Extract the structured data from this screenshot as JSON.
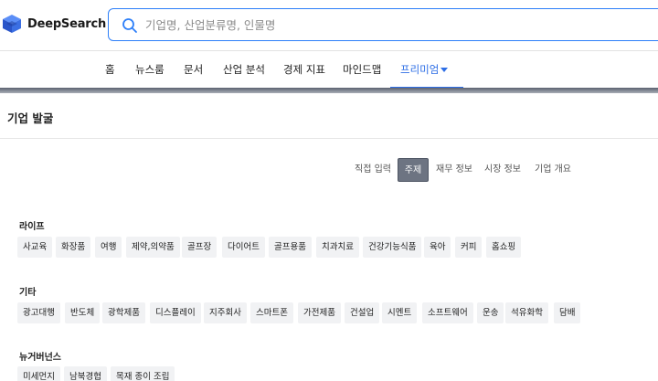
{
  "brand": {
    "name": "DeepSearch"
  },
  "search": {
    "placeholder": "기업명, 산업분류명, 인물명"
  },
  "nav": [
    "홈",
    "뉴스룸",
    "문서",
    "산업 분석",
    "경제 지표",
    "마인드맵",
    "프리미엄"
  ],
  "nav_active": "프리미엄",
  "page_title": "기업 발굴",
  "tabs": [
    "직접 입력",
    "주제",
    "재무 정보",
    "시장 정보",
    "기업 개요"
  ],
  "active_tab": "주제",
  "sections": [
    {
      "title": "라이프",
      "chips": [
        "사교육",
        "화장품",
        "여행",
        "제약,의약품",
        "골프장",
        "다이어트",
        "골프용품",
        "치과치료",
        "건강기능식품",
        "육아",
        "커피",
        "홈쇼핑"
      ]
    },
    {
      "title": "기타",
      "chips": [
        "광고대행",
        "반도체",
        "광학제품",
        "디스플레이",
        "지주회사",
        "스마트폰",
        "가전제품",
        "건설업",
        "시멘트",
        "소프트웨어",
        "운송",
        "석유화학",
        "담배"
      ]
    },
    {
      "title": "뉴거버넌스",
      "chips": [
        "미세먼지",
        "남북경협",
        "목재 종이 조립"
      ]
    }
  ],
  "colors": {
    "accent": "#2d6ee6",
    "search_border": "#2d7ff9",
    "active_tab_bg": "#6d7482",
    "chip_bg": "#f1f2f4"
  }
}
